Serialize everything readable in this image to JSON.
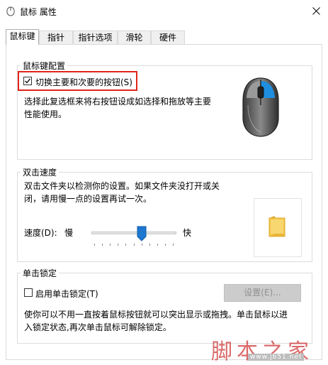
{
  "window": {
    "title": "鼠标 属性",
    "icons": {
      "app": "mouse-icon",
      "close": "close-icon"
    }
  },
  "tabs": [
    {
      "label": "鼠标键",
      "selected": true
    },
    {
      "label": "指针"
    },
    {
      "label": "指针选项"
    },
    {
      "label": "滑轮"
    },
    {
      "label": "硬件"
    }
  ],
  "button_config": {
    "group_label": "鼠标键配置",
    "switch_checkbox": {
      "label": "切换主要和次要的按钮(S)",
      "checked": true
    },
    "description_line1": "选择此复选框来将右按钮设成如选择和拖放等主要",
    "description_line2": "性能使用。",
    "illustration": "mouse-illustration-icon"
  },
  "double_click": {
    "group_label": "双击速度",
    "description_line1": "双击文件夹以检测你的设置。如果文件夹没打开或关",
    "description_line2": "闭，请用慢一点的设置再试一次。",
    "speed_label": "速度(D):",
    "slow_label": "慢",
    "fast_label": "快",
    "speed_fraction": 0.6,
    "test_icon": "folder-icon"
  },
  "click_lock": {
    "group_label": "单击锁定",
    "checkbox": {
      "label": "启用单击锁定(T)",
      "checked": false
    },
    "settings_button": "设置(E)...",
    "settings_enabled": false,
    "description_line1": "使你可以不用一直按着鼠标按钮就可以突出显示或拖拽。单击鼠标以进",
    "description_line2": "入锁定状态,再次单击鼠标可解除锁定。"
  },
  "watermark": {
    "text": "脚本之家",
    "url": "www.jb51.net"
  },
  "colors": {
    "highlight": "#e0251b",
    "mouse_accent": "#1e8fe0",
    "watermark": "#cc2a2a",
    "folder": "#f5c94a"
  }
}
